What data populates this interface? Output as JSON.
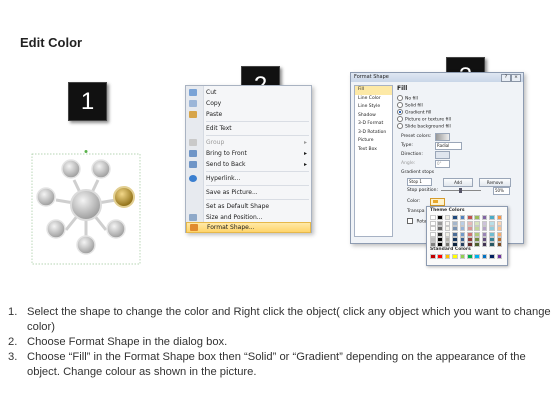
{
  "title": "Edit Color",
  "steps": [
    "1",
    "2",
    "3"
  ],
  "colors": {
    "step_box": "#111111",
    "gold_circle": "#b8921e",
    "grey_circle": "#c8c8c8",
    "highlight": "#ffd46a",
    "selection_green": "#59b34a"
  },
  "context_menu": {
    "items": [
      {
        "label": "Cut",
        "icon": "cut-icon",
        "disabled": false
      },
      {
        "label": "Copy",
        "icon": "copy-icon",
        "disabled": false
      },
      {
        "label": "Paste",
        "icon": "paste-icon",
        "disabled": false
      },
      {
        "label": "Edit Text",
        "icon": "",
        "disabled": false
      },
      {
        "label": "Group",
        "icon": "group-icon",
        "disabled": true,
        "submenu": true
      },
      {
        "label": "Bring to Front",
        "icon": "bring-front-icon",
        "disabled": false,
        "submenu": true
      },
      {
        "label": "Send to Back",
        "icon": "send-back-icon",
        "disabled": false,
        "submenu": true
      },
      {
        "label": "Hyperlink...",
        "icon": "hyperlink-icon",
        "disabled": false
      },
      {
        "label": "Save as Picture...",
        "icon": "",
        "disabled": false
      },
      {
        "label": "Set as Default Shape",
        "icon": "",
        "disabled": false
      },
      {
        "label": "Size and Position...",
        "icon": "size-icon",
        "disabled": false
      },
      {
        "label": "Format Shape...",
        "icon": "format-icon",
        "disabled": false,
        "highlighted": true
      }
    ]
  },
  "format_dialog": {
    "title": "Format Shape",
    "categories": [
      "Fill",
      "Line Color",
      "Line Style",
      "Shadow",
      "3-D Format",
      "3-D Rotation",
      "Picture",
      "Text Box"
    ],
    "selected_category": "Fill",
    "heading": "Fill",
    "fill_options": [
      "No fill",
      "Solid fill",
      "Gradient fill",
      "Picture or texture fill",
      "Slide background fill"
    ],
    "selected_fill": "Gradient fill",
    "fields": {
      "preset_colors": "Preset colors:",
      "type": "Type:",
      "type_value": "Radial",
      "direction": "Direction:",
      "angle": "Angle:",
      "angle_value": "0°",
      "gradient_stops": "Gradient stops",
      "stop_value": "Stop 1",
      "add": "Add",
      "remove": "Remove",
      "stop_position": "Stop position:",
      "stop_position_value": "50%",
      "color": "Color:",
      "transparency": "Transpa",
      "rotate": "Rotate"
    },
    "palette": {
      "theme_label": "Theme Colors",
      "standard_label": "Standard Colors",
      "theme_top": [
        "#ffffff",
        "#000000",
        "#eeece1",
        "#1f497d",
        "#4f81bd",
        "#c0504d",
        "#9bbb59",
        "#8064a2",
        "#4bacc6",
        "#f79646"
      ],
      "standard": [
        "#c00000",
        "#ff0000",
        "#ffc000",
        "#ffff00",
        "#92d050",
        "#00b050",
        "#00b0f0",
        "#0070c0",
        "#002060",
        "#7030a0"
      ]
    }
  },
  "instructions": [
    {
      "num": "1.",
      "text": "Select the shape to change the color and Right click the object( click any object which you want to change color)"
    },
    {
      "num": "2.",
      "text": "Choose Format Shape in the dialog box."
    },
    {
      "num": "3.",
      "text": "Choose “Fill” in the Format Shape box then “Solid” or “Gradient” depending on the appearance of the object. Change colour as shown in the picture."
    }
  ]
}
